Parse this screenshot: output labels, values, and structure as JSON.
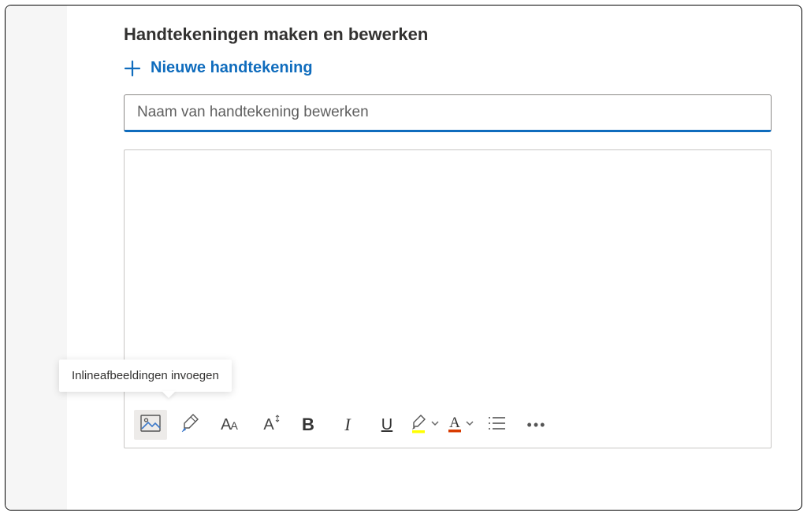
{
  "header": {
    "title": "Handtekeningen maken en bewerken"
  },
  "actions": {
    "new_signature_label": "Nieuwe handtekening"
  },
  "form": {
    "name_placeholder": "Naam van handtekening bewerken"
  },
  "toolbar": {
    "insert_image_tooltip": "Inlineafbeeldingen invoegen",
    "icons": {
      "insert_image": "image-icon",
      "format_painter": "paintbrush-icon",
      "font_face": "font-face-icon",
      "font_size": "font-size-icon",
      "bold": "B",
      "italic": "I",
      "underline": "U",
      "highlight": "highlight-icon",
      "font_color": "font-color-icon",
      "bullets": "list-icon",
      "more": "…"
    },
    "colors": {
      "highlight": "#ffff00",
      "font_color_underline": "#d83b01"
    }
  }
}
